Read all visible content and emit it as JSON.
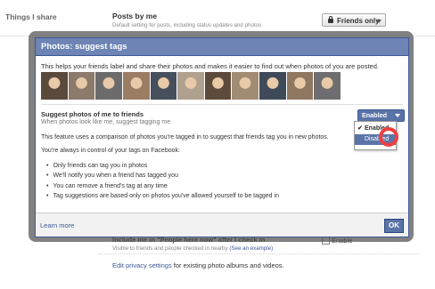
{
  "background": {
    "section_label": "Things I share",
    "posts": {
      "title": "Posts by me",
      "description": "Default setting for posts, including status updates and photos",
      "dropdown_label": "Friends only"
    },
    "include": {
      "title": "Include me in \"People here now\" after I check in",
      "description_prefix": "Visible to friends and people checked in nearby",
      "description_link": "(See an example)",
      "checkbox_label": "Enable",
      "checked": true
    },
    "privacy": {
      "link": "Edit privacy settings",
      "suffix": "for existing photo albums and videos."
    }
  },
  "dialog": {
    "title": "Photos: suggest tags",
    "intro": "This helps your friends label and share their photos and makes it easier to find out when photos of you are posted.",
    "photos": [
      "#5a4a3c",
      "#8c7a6b",
      "#6b6b6b",
      "#9b7d63",
      "#46505c",
      "#b0a08e",
      "#5c4a3a",
      "#a08c72",
      "#3e4a58",
      "#907760",
      "#6e6e70"
    ],
    "suggest_title": "Suggest photos of me to friends",
    "suggest_sub": "When photos look like me, suggest tagging me",
    "select_value": "Enabled",
    "menu_options": [
      {
        "label": "Enabled",
        "checked": true
      },
      {
        "label": "Disabled",
        "selected": true
      }
    ],
    "paragraph1": "This feature uses a comparison of photos you're tagged in to suggest that friends tag you in new photos.",
    "paragraph2": "You're always in control of your tags on Facebook:",
    "bullets": [
      "Only friends can tag you in photos",
      "We'll notify you when a friend has tagged you",
      "You can remove a friend's tag at any time",
      "Tag suggestions are based only on photos you've allowed yourself to be tagged in"
    ],
    "learn_more": "Learn more",
    "ok": "OK"
  },
  "colors": {
    "facebook_blue": "#3b5998",
    "header_blue": "#6d84b4",
    "highlight_red": "#ef3f3f"
  }
}
